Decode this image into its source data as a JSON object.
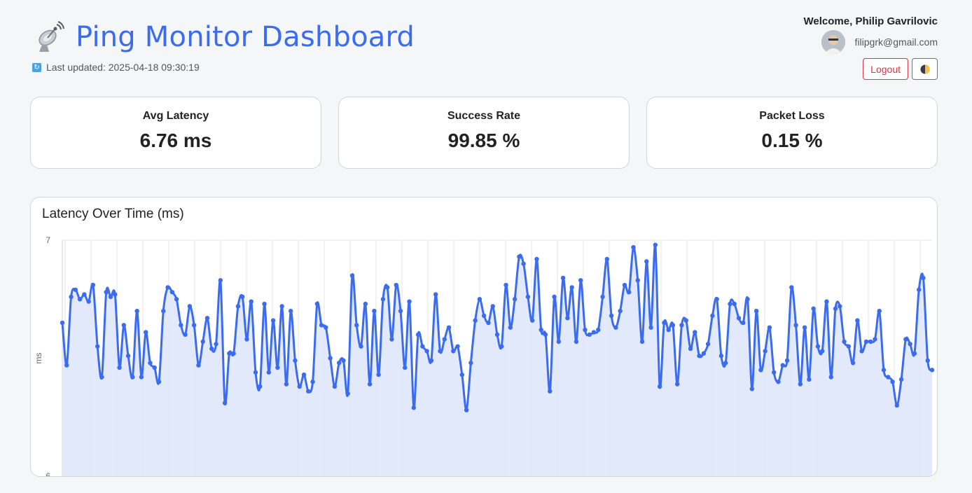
{
  "header": {
    "title": "Ping Monitor Dashboard",
    "title_icon": "satellite-antenna-icon",
    "last_updated": "Last updated: 2025-04-18 09:30:19",
    "refresh_icon": "refresh-icon"
  },
  "user": {
    "welcome": "Welcome, Philip Gavrilovic",
    "email": "filipgrk@gmail.com",
    "logout_label": "Logout",
    "theme_icon": "half-moon-theme-icon"
  },
  "stats": [
    {
      "label": "Avg Latency",
      "value": "6.76 ms"
    },
    {
      "label": "Success Rate",
      "value": "99.85 %"
    },
    {
      "label": "Packet Loss",
      "value": "0.15 %"
    }
  ],
  "colors": {
    "accent": "#3b6cf0",
    "line": "#3b6cf0",
    "fill": "#e0e8fb",
    "danger": "#dc3545"
  },
  "chart_data": {
    "type": "line",
    "title": "Latency Over Time (ms)",
    "ylabel": "ms",
    "ylim": [
      6,
      7
    ],
    "yticks": [
      "7",
      "6"
    ],
    "grid": true,
    "fill": true,
    "values": [
      6.65,
      6.47,
      6.76,
      6.79,
      6.75,
      6.77,
      6.74,
      6.81,
      6.55,
      6.42,
      6.78,
      6.76,
      6.77,
      6.46,
      6.64,
      6.51,
      6.42,
      6.7,
      6.42,
      6.61,
      6.48,
      6.46,
      6.4,
      6.7,
      6.8,
      6.78,
      6.75,
      6.64,
      6.6,
      6.72,
      6.64,
      6.47,
      6.57,
      6.67,
      6.54,
      6.56,
      6.83,
      6.31,
      6.52,
      6.52,
      6.72,
      6.76,
      6.58,
      6.74,
      6.44,
      6.38,
      6.73,
      6.44,
      6.66,
      6.46,
      6.72,
      6.39,
      6.7,
      6.49,
      6.38,
      6.43,
      6.36,
      6.4,
      6.73,
      6.64,
      6.63,
      6.5,
      6.38,
      6.48,
      6.49,
      6.35,
      6.85,
      6.64,
      6.55,
      6.73,
      6.39,
      6.7,
      6.43,
      6.75,
      6.8,
      6.58,
      6.81,
      6.7,
      6.46,
      6.74,
      6.29,
      6.6,
      6.55,
      6.53,
      6.49,
      6.77,
      6.53,
      6.58,
      6.63,
      6.53,
      6.55,
      6.43,
      6.28,
      6.48,
      6.66,
      6.75,
      6.68,
      6.65,
      6.72,
      6.6,
      6.55,
      6.81,
      6.63,
      6.75,
      6.93,
      6.9,
      6.76,
      6.66,
      6.92,
      6.62,
      6.6,
      6.36,
      6.76,
      6.57,
      6.84,
      6.67,
      6.8,
      6.57,
      6.83,
      6.62,
      6.6,
      6.61,
      6.62,
      6.76,
      6.92,
      6.68,
      6.63,
      6.7,
      6.81,
      6.78,
      6.97,
      6.83,
      6.57,
      6.91,
      6.63,
      6.98,
      6.38,
      6.65,
      6.62,
      6.64,
      6.39,
      6.64,
      6.66,
      6.54,
      6.61,
      6.51,
      6.52,
      6.56,
      6.68,
      6.75,
      6.51,
      6.48,
      6.73,
      6.73,
      6.67,
      6.65,
      6.75,
      6.37,
      6.7,
      6.45,
      6.53,
      6.63,
      6.44,
      6.4,
      6.47,
      6.49,
      6.8,
      6.64,
      6.39,
      6.63,
      6.41,
      6.71,
      6.55,
      6.53,
      6.74,
      6.42,
      6.71,
      6.72,
      6.57,
      6.55,
      6.48,
      6.66,
      6.53,
      6.57,
      6.57,
      6.58,
      6.7,
      6.45,
      6.42,
      6.4,
      6.3,
      6.41,
      6.58,
      6.56,
      6.52,
      6.79,
      6.84,
      6.49,
      6.45
    ]
  }
}
